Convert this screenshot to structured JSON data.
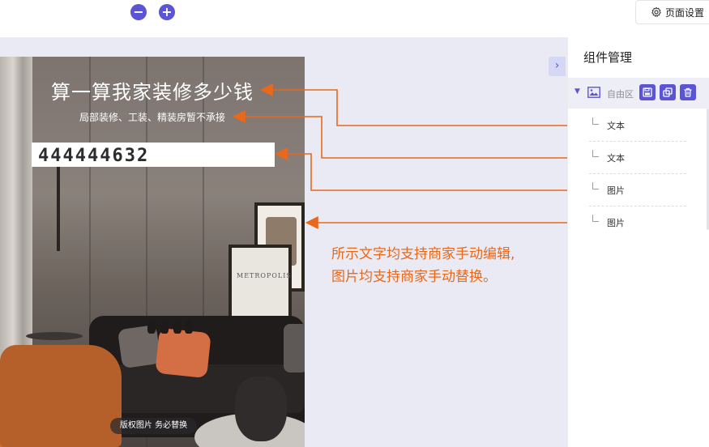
{
  "toolbar": {
    "zoom_out": "−",
    "zoom_in": "+",
    "page_settings_label": "页面设置"
  },
  "poster": {
    "title": "算一算我家装修多少钱",
    "subtitle": "局部装修、工装、精装房暂不承接",
    "number_banner": "444444632",
    "copyright_label": "版权图片 务必替换",
    "frame_text": "METROPOLIS"
  },
  "annotation": {
    "line1": "所示文字均支持商家手动编辑,",
    "line2": "图片均支持商家手动替换。",
    "color": "#e8691b"
  },
  "panel": {
    "title": "组件管理",
    "group_label": "自由区",
    "children": [
      {
        "label": "文本"
      },
      {
        "label": "文本"
      },
      {
        "label": "图片"
      },
      {
        "label": "图片"
      }
    ]
  },
  "colors": {
    "accent": "#5b55d6",
    "canvas_bg": "#e9eaf3",
    "annotation_orange": "#e8691b"
  }
}
